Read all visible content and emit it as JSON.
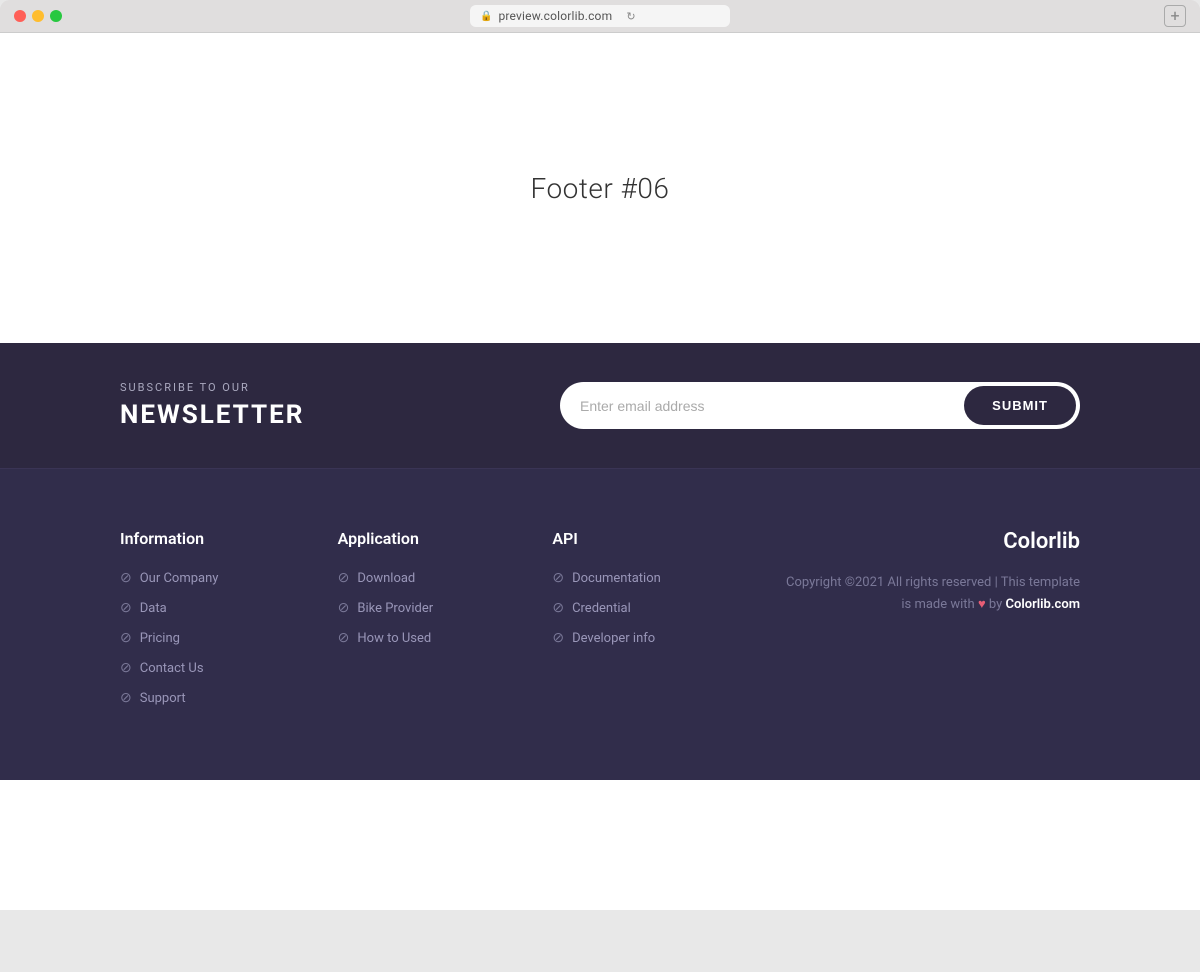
{
  "browser": {
    "url": "preview.colorlib.com",
    "new_tab_label": "+"
  },
  "page": {
    "title": "Footer #06"
  },
  "newsletter": {
    "subtitle": "SUBSCRIBE TO OUR",
    "title": "NEWSLETTER",
    "input_placeholder": "Enter email address",
    "submit_label": "SUBMIT"
  },
  "footer": {
    "columns": [
      {
        "id": "information",
        "title": "Information",
        "links": [
          {
            "label": "Our Company"
          },
          {
            "label": "Data"
          },
          {
            "label": "Pricing"
          },
          {
            "label": "Contact Us"
          },
          {
            "label": "Support"
          }
        ]
      },
      {
        "id": "application",
        "title": "Application",
        "links": [
          {
            "label": "Download"
          },
          {
            "label": "Bike Provider"
          },
          {
            "label": "How to Used"
          }
        ]
      },
      {
        "id": "api",
        "title": "API",
        "links": [
          {
            "label": "Documentation"
          },
          {
            "label": "Credential"
          },
          {
            "label": "Developer info"
          }
        ]
      }
    ],
    "brand": {
      "name": "Colorlib",
      "copyright_text": "Copyright ©2021 All rights reserved | This template is made with",
      "copyright_by": "by",
      "copyright_link": "Colorlib.com"
    }
  }
}
